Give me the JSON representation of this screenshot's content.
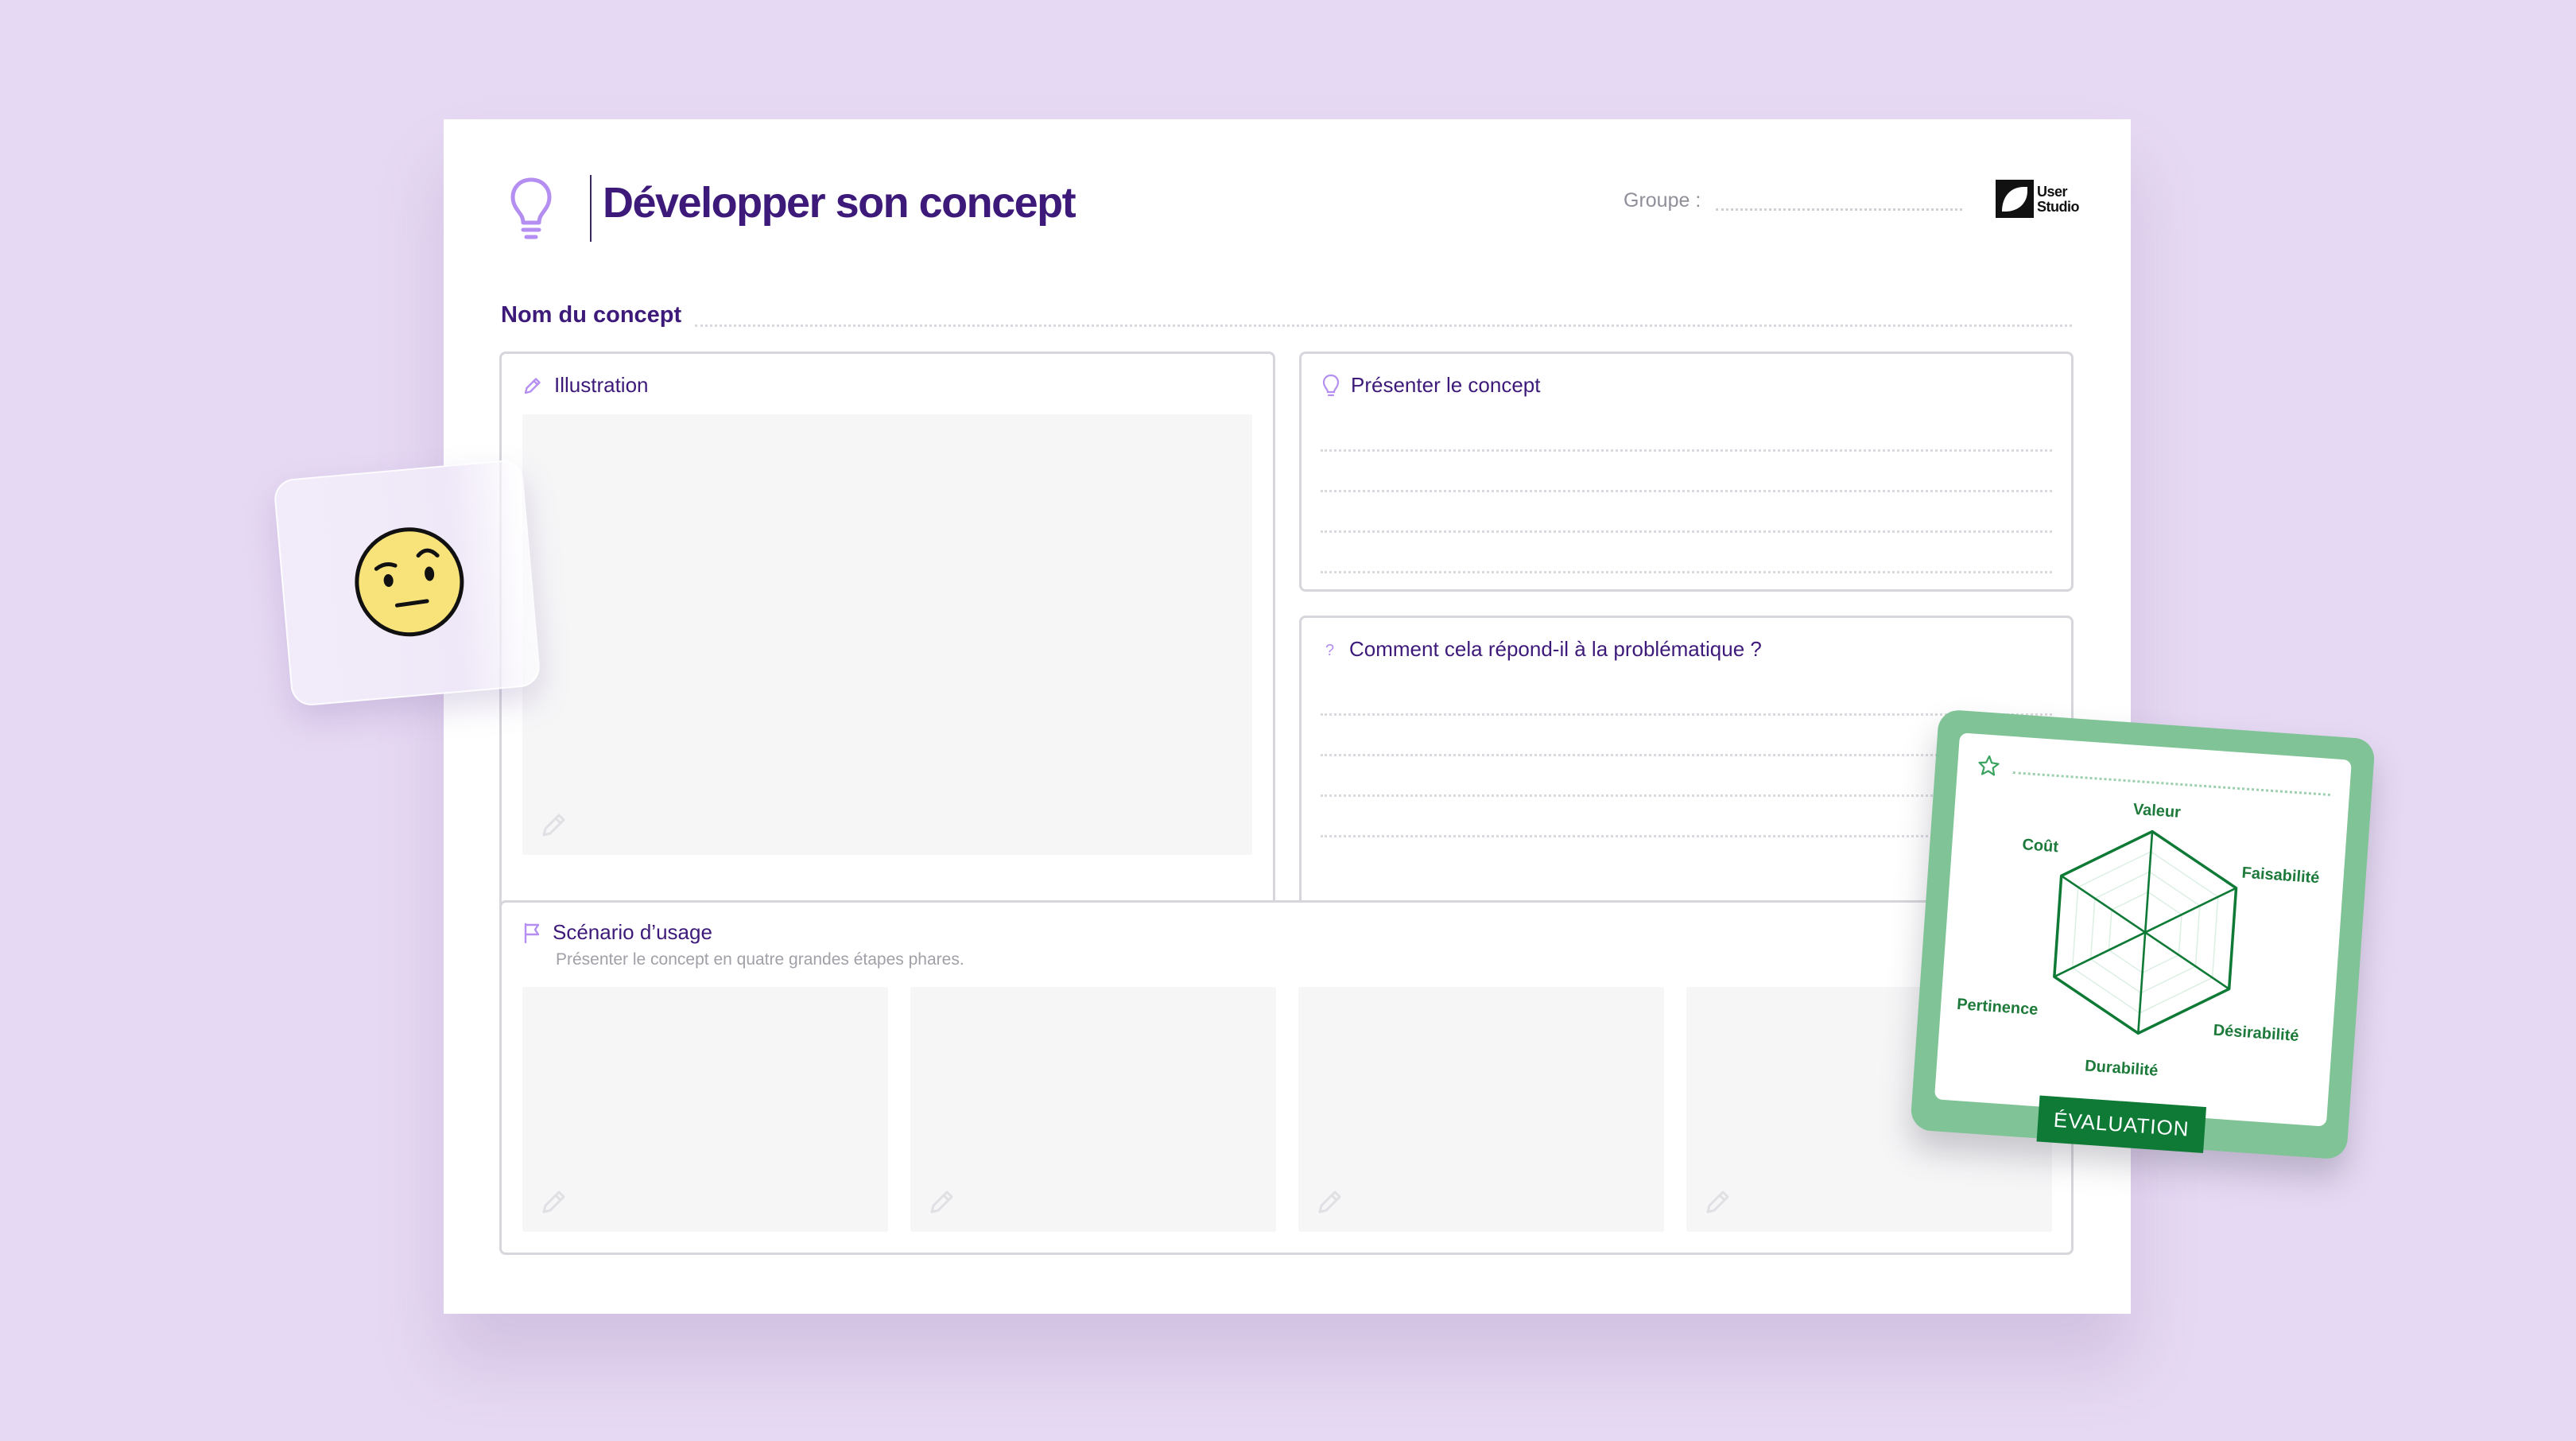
{
  "sheet": {
    "title": "Développer son concept",
    "group_label": "Groupe :",
    "brand": {
      "line1": "User",
      "line2": "Studio"
    },
    "concept_name_label": "Nom du concept"
  },
  "panels": {
    "illustration": {
      "title": "Illustration"
    },
    "present": {
      "title": "Présenter le concept"
    },
    "question": {
      "title": "Comment cela répond-il à la problématique ?"
    },
    "scenario": {
      "title": "Scénario d’usage",
      "subtitle": "Présenter le concept en quatre grandes étapes phares."
    }
  },
  "evaluation_card": {
    "tag": "ÉVALUATION",
    "axes": [
      "Valeur",
      "Faisabilité",
      "Désirabilité",
      "Durabilité",
      "Pertinence",
      "Coût"
    ]
  },
  "colors": {
    "background": "#e6d9f3",
    "title": "#3d1a7a",
    "accent_purple": "#b48ef0",
    "card_green": "#7fc396",
    "green_dark": "#0e7a36",
    "emoji_yellow": "#f7e37a"
  },
  "icons": {
    "title": "lightbulb-icon",
    "illustration": "pencil-icon",
    "present": "lightbulb-icon",
    "question": "question-mark-icon",
    "scenario": "flag-icon",
    "evaluation": "star-icon",
    "sticker": "skeptical-face-emoji"
  }
}
